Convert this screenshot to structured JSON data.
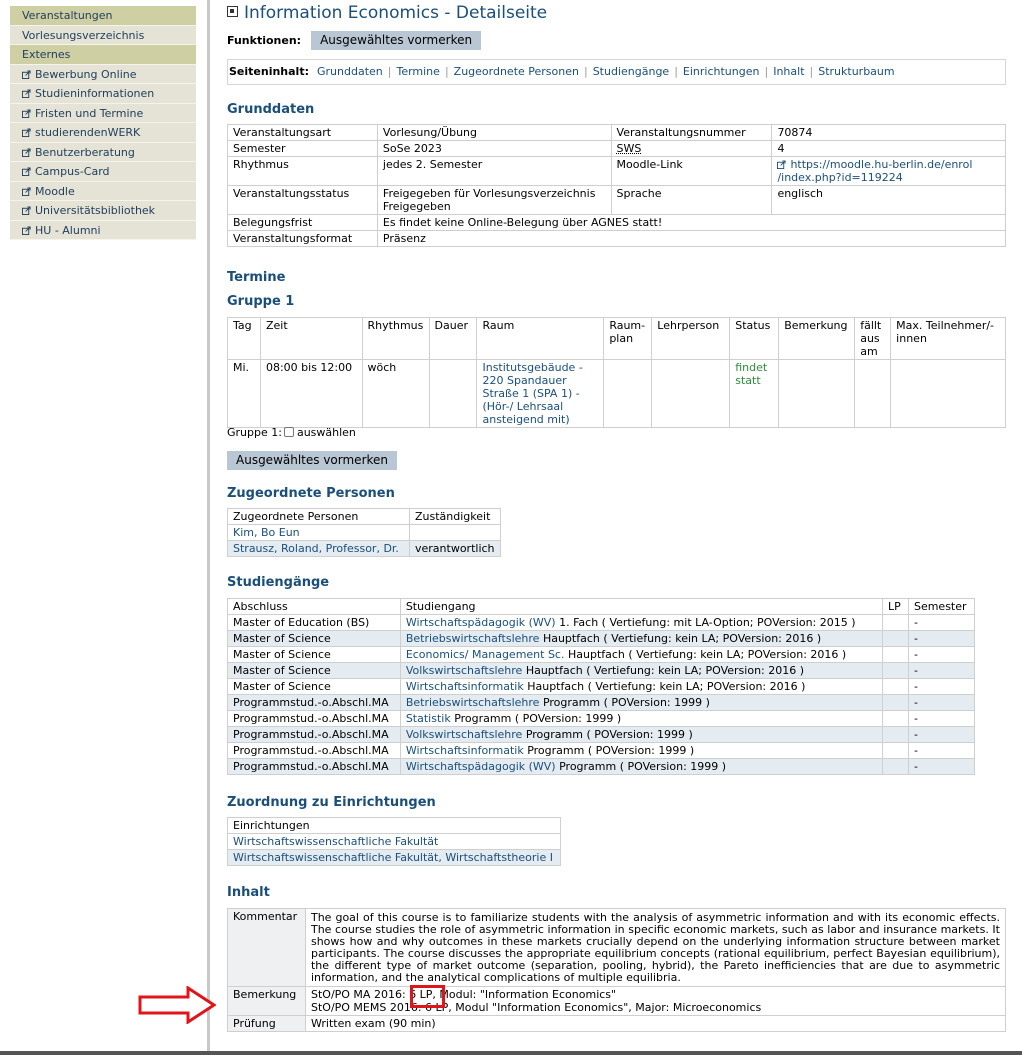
{
  "sidebar": {
    "items": [
      {
        "label": "Veranstaltungen",
        "external": false,
        "dark": true
      },
      {
        "label": "Vorlesungsverzeichnis",
        "external": false,
        "dark": false
      },
      {
        "label": "Externes",
        "external": false,
        "dark": true
      },
      {
        "label": "Bewerbung Online",
        "external": true,
        "dark": false
      },
      {
        "label": "Studieninformationen",
        "external": true,
        "dark": false
      },
      {
        "label": "Fristen und Termine",
        "external": true,
        "dark": false
      },
      {
        "label": "studierendenWERK",
        "external": true,
        "dark": false
      },
      {
        "label": "Benutzerberatung",
        "external": true,
        "dark": false
      },
      {
        "label": "Campus-Card",
        "external": true,
        "dark": false
      },
      {
        "label": "Moodle",
        "external": true,
        "dark": false
      },
      {
        "label": "Universitätsbibliothek",
        "external": true,
        "dark": false
      },
      {
        "label": "HU - Alumni",
        "external": true,
        "dark": false
      }
    ]
  },
  "page": {
    "title": "Information Economics - Detailseite",
    "functions_label": "Funktionen:",
    "reserve_button": "Ausgewähltes vormerken",
    "content_label": "Seiteninhalt:",
    "content_links": [
      "Grunddaten",
      "Termine",
      "Zugeordnete Personen",
      "Studiengänge",
      "Einrichtungen",
      "Inhalt",
      "Strukturbaum"
    ]
  },
  "grunddaten": {
    "heading": "Grunddaten",
    "veranstaltungsart_label": "Veranstaltungsart",
    "veranstaltungsart": "Vorlesung/Übung",
    "veranstaltungsnummer_label": "Veranstaltungsnummer",
    "veranstaltungsnummer": "70874",
    "semester_label": "Semester",
    "semester": "SoSe 2023",
    "sws_label": "SWS",
    "sws": "4",
    "rhythmus_label": "Rhythmus",
    "rhythmus": "jedes 2. Semester",
    "moodle_label": "Moodle-Link",
    "moodle_link_line1": "https://moodle.hu-berlin.de/enrol",
    "moodle_link_line2": "/index.php?id=119224",
    "status_label": "Veranstaltungsstatus",
    "status_line1": "Freigegeben für Vorlesungsverzeichnis",
    "status_line2": "Freigegeben",
    "sprache_label": "Sprache",
    "sprache": "englisch",
    "belegungsfrist_label": "Belegungsfrist",
    "belegungsfrist": "Es findet keine Online-Belegung über AGNES statt!",
    "format_label": "Veranstaltungsformat",
    "format": "Präsenz"
  },
  "termine": {
    "heading": "Termine",
    "group_heading": "Gruppe 1",
    "columns": [
      "Tag",
      "Zeit",
      "Rhythmus",
      "Dauer",
      "Raum",
      "Raum-plan",
      "Lehrperson",
      "Status",
      "Bemerkung",
      "fällt aus am",
      "Max. Teilnehmer/-innen"
    ],
    "row": {
      "tag": "Mi.",
      "zeit": "08:00 bis 12:00",
      "rhythmus": "wöch",
      "dauer": "",
      "raum_line1": "Institutsgebäude -",
      "raum_line2": "220 Spandauer",
      "raum_line3": "Straße 1 (SPA 1) -",
      "raum_line4": "(Hör-/ Lehrsaal",
      "raum_line5": "ansteigend mit)",
      "status_line1": "findet",
      "status_line2": "statt"
    },
    "select_label": "Gruppe 1:",
    "select_text": "auswählen",
    "reserve_button": "Ausgewähltes vormerken"
  },
  "personen": {
    "heading": "Zugeordnete Personen",
    "col_person": "Zugeordnete Personen",
    "col_role": "Zuständigkeit",
    "rows": [
      {
        "name": "Kim, Bo Eun",
        "role": ""
      },
      {
        "name": "Strausz, Roland, Professor, Dr.",
        "role": "verantwortlich"
      }
    ]
  },
  "studiengaenge": {
    "heading": "Studiengänge",
    "columns": [
      "Abschluss",
      "Studiengang",
      "LP",
      "Semester"
    ],
    "rows": [
      {
        "abschluss": "Master of Education (BS)",
        "link": "Wirtschaftspädagogik (WV)",
        "rest": " 1. Fach ( Vertiefung: mit LA-Option; POVersion: 2015 )",
        "lp": "",
        "semester": "-"
      },
      {
        "abschluss": "Master of Science",
        "link": "Betriebswirtschaftslehre",
        "rest": " Hauptfach ( Vertiefung: kein LA; POVersion: 2016 )",
        "lp": "",
        "semester": "-"
      },
      {
        "abschluss": "Master of Science",
        "link": "Economics/ Management Sc.",
        "rest": " Hauptfach ( Vertiefung: kein LA; POVersion: 2016 )",
        "lp": "",
        "semester": "-"
      },
      {
        "abschluss": "Master of Science",
        "link": "Volkswirtschaftslehre",
        "rest": " Hauptfach ( Vertiefung: kein LA; POVersion: 2016 )",
        "lp": "",
        "semester": "-"
      },
      {
        "abschluss": "Master of Science",
        "link": "Wirtschaftsinformatik",
        "rest": " Hauptfach ( Vertiefung: kein LA; POVersion: 2016 )",
        "lp": "",
        "semester": "-"
      },
      {
        "abschluss": "Programmstud.-o.Abschl.MA",
        "link": "Betriebswirtschaftslehre",
        "rest": " Programm ( POVersion: 1999 )",
        "lp": "",
        "semester": "-"
      },
      {
        "abschluss": "Programmstud.-o.Abschl.MA",
        "link": "Statistik",
        "rest": " Programm ( POVersion: 1999 )",
        "lp": "",
        "semester": "-"
      },
      {
        "abschluss": "Programmstud.-o.Abschl.MA",
        "link": "Volkswirtschaftslehre",
        "rest": " Programm ( POVersion: 1999 )",
        "lp": "",
        "semester": "-"
      },
      {
        "abschluss": "Programmstud.-o.Abschl.MA",
        "link": "Wirtschaftsinformatik",
        "rest": " Programm ( POVersion: 1999 )",
        "lp": "",
        "semester": "-"
      },
      {
        "abschluss": "Programmstud.-o.Abschl.MA",
        "link": "Wirtschaftspädagogik (WV)",
        "rest": " Programm ( POVersion: 1999 )",
        "lp": "",
        "semester": "-"
      }
    ]
  },
  "einrichtungen": {
    "heading": "Zuordnung zu Einrichtungen",
    "col": "Einrichtungen",
    "rows": [
      "Wirtschaftswissenschaftliche Fakultät",
      "Wirtschaftswissenschaftliche Fakultät, Wirtschaftstheorie I"
    ]
  },
  "inhalt": {
    "heading": "Inhalt",
    "kommentar_label": "Kommentar",
    "kommentar": "The goal of this course is to familiarize students with the analysis of asymmetric information and with its economic effects. The course studies the role of asymmetric information in specific economic markets, such as labor and insurance markets. It shows how and why outcomes in these markets crucially depend on the underlying information structure between market participants. The course discusses the appropriate equilibrium concepts (rational equilibrium, perfect Bayesian equilibrium), the different type of market outcome (separation, pooling, hybrid), the Pareto inefficiencies that are due to asymmetric information, and the analytical complications of multiple equilibria.",
    "bemerkung_label": "Bemerkung",
    "bemerkung_line1": "StO/PO MA 2016: 6 LP, Modul: \"Information Economics\"",
    "bemerkung_line2": "StO/PO MEMS 2016: 6 LP, Modul \"Information Economics\", Major: Microeconomics",
    "pruefung_label": "Prüfung",
    "pruefung": "Written exam (90 min)"
  },
  "colors": {
    "accent": "#1b4f7a",
    "annotation": "#e0151b",
    "status_green": "#2e8b3a"
  }
}
